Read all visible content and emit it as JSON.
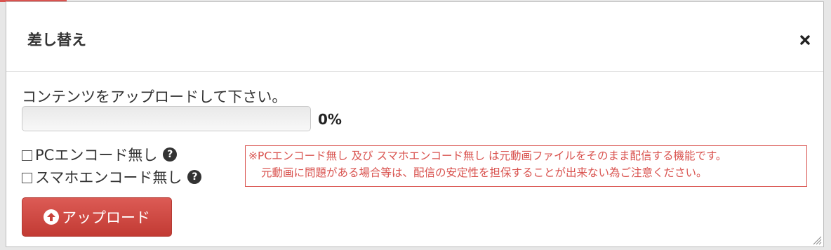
{
  "dialog": {
    "title": "差し替え",
    "close_icon": "close-icon"
  },
  "upload": {
    "prompt": "コンテンツをアップロードして下さい。",
    "progress_percent": 0,
    "progress_text": "0%",
    "button_label": "アップロード",
    "button_icon": "upload-arrow-icon"
  },
  "options": [
    {
      "label": "PCエンコード無し",
      "checked": false,
      "help_icon": "question-icon"
    },
    {
      "label": "スマホエンコード無し",
      "checked": false,
      "help_icon": "question-icon"
    }
  ],
  "notice": {
    "line1": "※PCエンコード無し 及び スマホエンコード無し は元動画ファイルをそのまま配信する機能です。",
    "line2": "元動画に問題がある場合等は、配信の安定性を担保することが出来ない為ご注意ください。"
  },
  "colors": {
    "accent": "#d9534f",
    "button": "#c9423b"
  }
}
